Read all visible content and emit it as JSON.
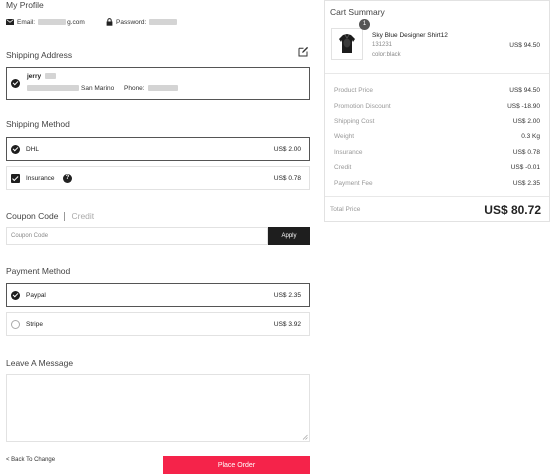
{
  "profile": {
    "title": "My Profile",
    "email_label": "Email:",
    "email_value_suffix": "g.com",
    "password_label": "Password:"
  },
  "shipping_address": {
    "title": "Shipping Address",
    "name": "jerry",
    "city": "San Marino",
    "phone_label": "Phone:"
  },
  "shipping_method": {
    "title": "Shipping Method",
    "options": [
      {
        "label": "DHL",
        "price": "US$ 2.00",
        "selected": true
      },
      {
        "label": "Insurance",
        "price": "US$ 0.78",
        "checked": true
      }
    ]
  },
  "coupon": {
    "tab_active": "Coupon Code",
    "tab_inactive": "Credit",
    "placeholder": "Coupon Code",
    "apply_label": "Apply"
  },
  "payment_method": {
    "title": "Payment Method",
    "options": [
      {
        "label": "Paypal",
        "price": "US$ 2.35",
        "selected": true
      },
      {
        "label": "Stripe",
        "price": "US$ 3.92",
        "selected": false
      }
    ]
  },
  "message": {
    "title": "Leave A Message"
  },
  "footer": {
    "back_label": "< Back To Change",
    "place_order_label": "Place Order"
  },
  "cart": {
    "title": "Cart Summary",
    "item": {
      "quantity": "1",
      "name": "Sky Blue Designer Shirt12",
      "sku": "131231",
      "variant": "color:black",
      "price": "US$ 94.50"
    },
    "rows": [
      {
        "label": "Product Price",
        "value": "US$ 94.50"
      },
      {
        "label": "Promotion Discount",
        "value": "US$ -18.90"
      },
      {
        "label": "Shipping Cost",
        "value": "US$ 2.00"
      },
      {
        "label": "Weight",
        "value": "0.3 Kg"
      },
      {
        "label": "Insurance",
        "value": "US$ 0.78"
      },
      {
        "label": "Credit",
        "value": "US$ -0.01"
      },
      {
        "label": "Payment Fee",
        "value": "US$ 2.35"
      }
    ],
    "total_label": "Total Price",
    "total_value": "US$ 80.72"
  },
  "colors": {
    "accent": "#f5234a",
    "dark": "#1e1e1e",
    "border": "#e2e2e2"
  }
}
